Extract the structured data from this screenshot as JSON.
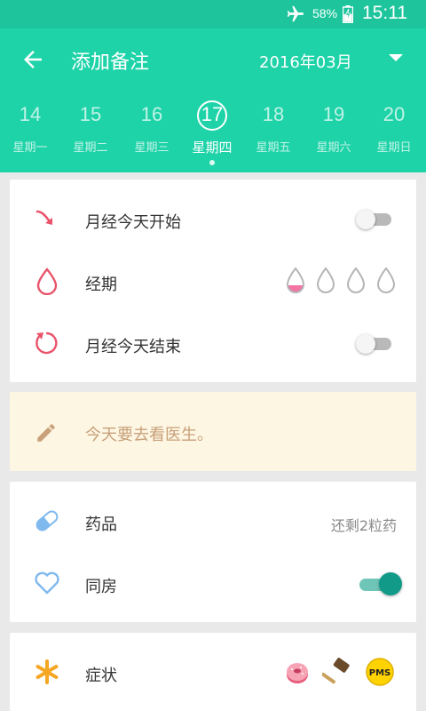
{
  "status_bar": {
    "battery_percent": "58%",
    "time": "15:11",
    "airplane_mode": "airplane-icon",
    "battery_icon": "battery-charging-icon"
  },
  "app_bar": {
    "back_icon": "arrow-back-icon",
    "title": "添加备注",
    "month": "2016年03月",
    "dropdown_icon": "triangle-down-icon"
  },
  "week": {
    "days": [
      {
        "num": "14",
        "label": "星期一"
      },
      {
        "num": "15",
        "label": "星期二"
      },
      {
        "num": "16",
        "label": "星期三"
      },
      {
        "num": "17",
        "label": "星期四",
        "selected": true
      },
      {
        "num": "18",
        "label": "星期五"
      },
      {
        "num": "19",
        "label": "星期六"
      },
      {
        "num": "20",
        "label": "星期日"
      }
    ]
  },
  "period_card": {
    "start": {
      "label": "月经今天开始",
      "icon": "period-start-arrow-icon",
      "toggle_on": false
    },
    "flow": {
      "label": "经期",
      "icon": "drop-icon",
      "levels": 4,
      "selected_level": 1
    },
    "end": {
      "label": "月经今天结束",
      "icon": "period-end-refresh-icon",
      "toggle_on": false
    }
  },
  "note": {
    "icon": "pencil-icon",
    "text": "今天要去看医生。"
  },
  "meds_card": {
    "medicine": {
      "label": "药品",
      "icon": "pill-icon",
      "remaining": "还剩2粒药"
    },
    "intimacy": {
      "label": "同房",
      "icon": "heart-outline-icon",
      "toggle_on": true
    }
  },
  "symptoms_card": {
    "label": "症状",
    "icon": "asterisk-icon",
    "symptom_icons": [
      "donut-icon",
      "hammer-icon",
      "pms-badge-icon"
    ],
    "pms_text": "PMS"
  },
  "colors": {
    "status_bar": "#1ec59c",
    "app_bar": "#1ed3a8",
    "accent_red": "#e9546b",
    "teal_toggle": "#119a88",
    "note_bg": "#fdf6e3",
    "note_text": "#c8a07a"
  }
}
